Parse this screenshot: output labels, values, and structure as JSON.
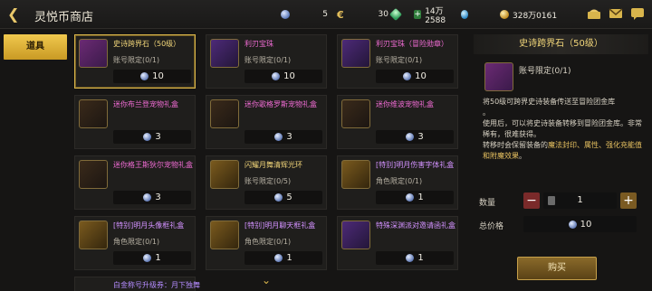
{
  "header": {
    "title": "灵悦币商店",
    "currencies": [
      {
        "value": "5"
      },
      {
        "value": "30"
      },
      {
        "value": "14万2588"
      },
      {
        "value": "328万0161"
      }
    ]
  },
  "tabs": [
    {
      "label": "道具"
    }
  ],
  "items": [
    {
      "name": "史诗跨界石（50级）",
      "limit": "账号限定(0/1)",
      "price": "10"
    },
    {
      "name": "利刃宝珠",
      "limit": "账号限定(0/1)",
      "price": "10"
    },
    {
      "name": "利刃宝珠（冒险勋章）",
      "limit": "账号限定(0/1)",
      "price": "10"
    },
    {
      "name": "迷你布兰登宠物礼盒",
      "limit": "",
      "price": "3"
    },
    {
      "name": "迷你歌格罗斯宠物礼盒",
      "limit": "",
      "price": "3"
    },
    {
      "name": "迷你维波宠物礼盒",
      "limit": "",
      "price": "3"
    },
    {
      "name": "迷你格王斯狄尔宠物礼盒",
      "limit": "",
      "price": "3"
    },
    {
      "name": "闪耀月舞清辉光环",
      "limit": "账号限定(0/5)",
      "price": "5"
    },
    {
      "name": "[特别]明月伤害字体礼盒",
      "limit": "角色限定(0/1)",
      "price": "1"
    },
    {
      "name": "[特别]明月头像框礼盒",
      "limit": "角色限定(0/1)",
      "price": "1"
    },
    {
      "name": "[特别]明月聊天框礼盒",
      "limit": "角色限定(0/1)",
      "price": "1"
    },
    {
      "name": "特殊深渊派对邀请函礼盒",
      "limit": "",
      "price": "1"
    },
    {
      "name": "白金称号升级券：月下独舞"
    }
  ],
  "detail": {
    "title": "史诗跨界石（50级）",
    "limit": "账号限定(0/1)",
    "desc_line1": "将50级可跨界史诗装备传送至冒险团金库",
    "desc_dot": "。",
    "desc_line2": "使用后，可以将史诗装备转移到冒险团金库。非常稀有，很难获得。",
    "desc_line3_a": "转移时会保留装备的",
    "desc_line3_b": "魔法封印、属性、强化充能值和附魔效果",
    "desc_line3_c": "。",
    "qty_label": "数量",
    "qty_value": "1",
    "total_label": "总价格",
    "total_value": "10",
    "buy_label": "购买"
  }
}
